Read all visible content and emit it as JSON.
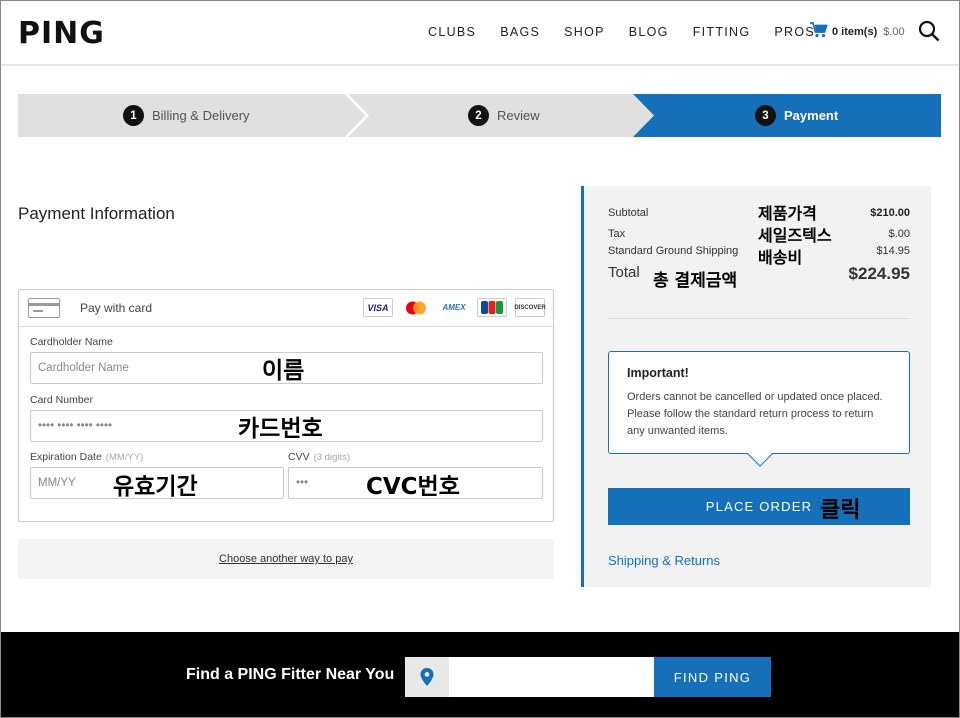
{
  "header": {
    "logo": "PING",
    "nav": [
      "CLUBS",
      "BAGS",
      "SHOP",
      "BLOG",
      "FITTING",
      "PROS"
    ],
    "cart_count": "0 item(s)",
    "cart_total": "$.00"
  },
  "steps": [
    {
      "num": "1",
      "label": "Billing & Delivery",
      "active": false
    },
    {
      "num": "2",
      "label": "Review",
      "active": false
    },
    {
      "num": "3",
      "label": "Payment",
      "active": true
    }
  ],
  "payment": {
    "title": "Payment Information",
    "pay_with_card": "Pay with card",
    "brands": [
      "VISA",
      "Mastercard",
      "AMEX",
      "JCB",
      "DISCOVER"
    ],
    "cardholder_label": "Cardholder Name",
    "cardholder_placeholder": "Cardholder Name",
    "card_number_label": "Card Number",
    "card_number_placeholder": "•••• •••• •••• ••••",
    "expiration_label": "Expiration Date",
    "expiration_hint": "(MM/YY)",
    "expiration_placeholder": "MM/YY",
    "cvv_label": "CVV",
    "cvv_hint": "(3 digits)",
    "cvv_placeholder": "•••",
    "alt_pay": "Choose another way to pay"
  },
  "annotations": {
    "name": "이름",
    "card_number": "카드번호",
    "expiration": "유효기간",
    "cvc": "CVC번호",
    "price": "제품가격",
    "tax": "세일즈텍스",
    "shipping": "배송비",
    "total": "총 결제금액",
    "click": "클릭"
  },
  "summary": {
    "subtotal_label": "Subtotal",
    "subtotal_value": "$210.00",
    "tax_label": "Tax",
    "tax_value": "$.00",
    "shipping_label": "Standard Ground Shipping",
    "shipping_value": "$14.95",
    "total_label": "Total",
    "total_value": "$224.95",
    "note_title": "Important!",
    "note_text": "Orders cannot be cancelled or updated once placed. Please follow the standard return process to return any unwanted items.",
    "place_order": "PLACE ORDER",
    "shipping_link": "Shipping & Returns"
  },
  "footer": {
    "text": "Find a PING Fitter Near You",
    "button": "FIND PING"
  },
  "colors": {
    "accent": "#1670b9",
    "step_inactive": "#e0e0e0",
    "footer_bg": "#000000"
  }
}
